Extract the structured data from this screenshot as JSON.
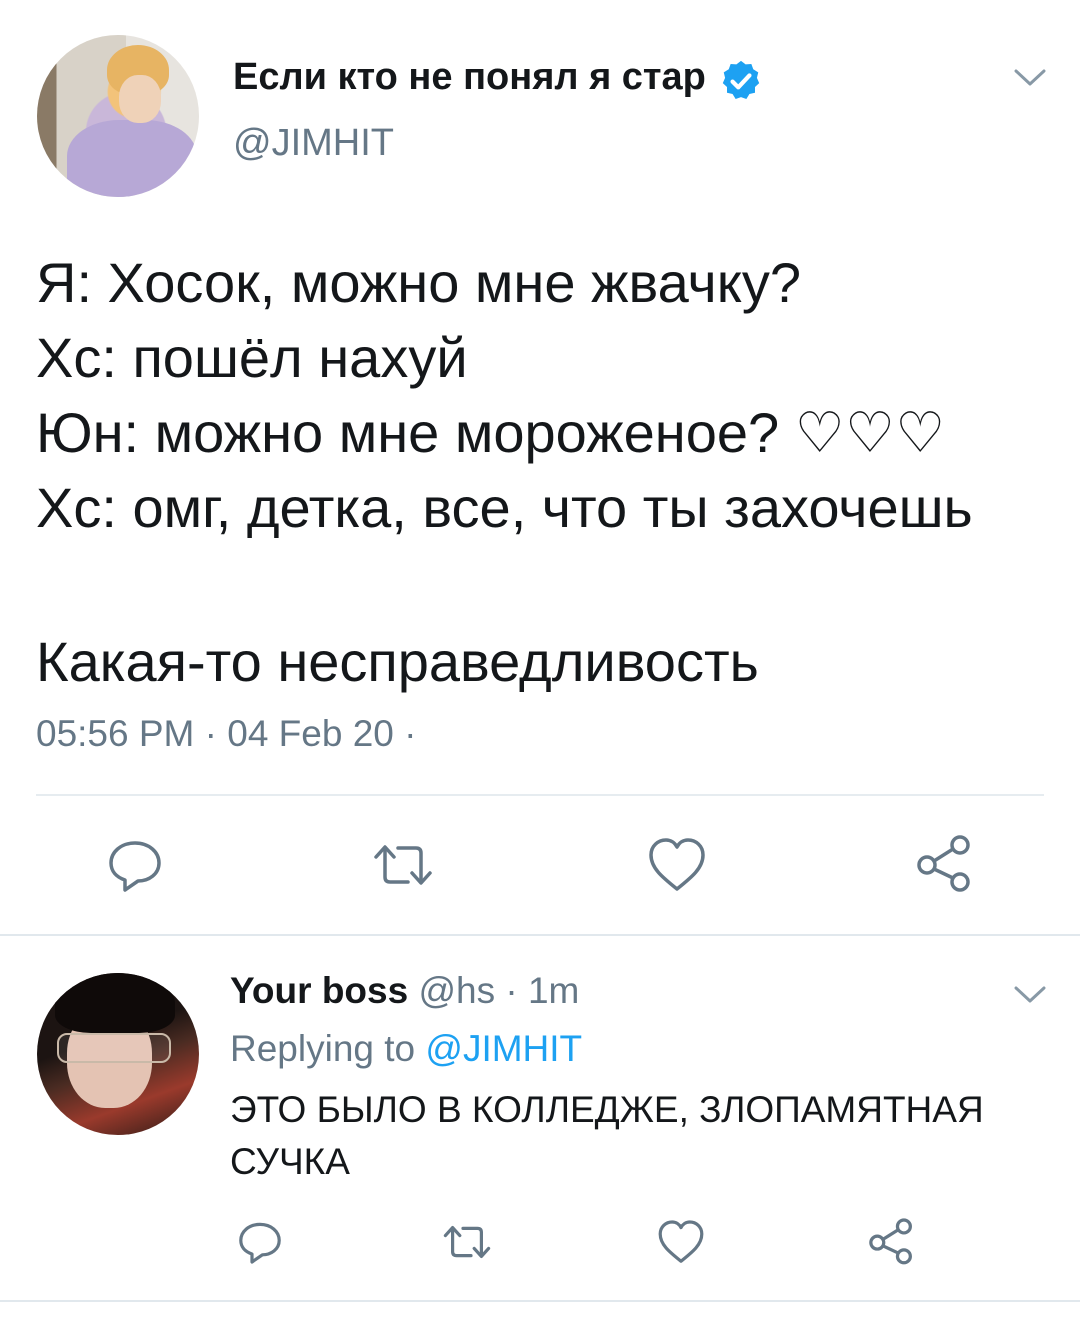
{
  "main_tweet": {
    "author_name": "Если кто не понял я стар",
    "author_handle": "@JIMHIT",
    "verified": true,
    "text_lines": [
      "Я: Хосок, можно мне жвачку?",
      "Хс: пошёл нахуй",
      "Юн: можно мне мороженое? ♡♡♡",
      "Хс: омг, детка, все, что ты захочешь"
    ],
    "text_after": "Какая-то несправедливость",
    "meta": "05:56 PM · 04 Feb 20 ·",
    "actions": [
      "reply-icon",
      "retweet-icon",
      "like-icon",
      "share-icon"
    ]
  },
  "reply": {
    "author_name": "Your boss",
    "author_handle": "@hs",
    "separator": "·",
    "time": "1m",
    "replying_to_label": "Replying to",
    "replying_to_handle": "@JIMHIT",
    "text_lines": [
      "ЭТО БЫЛО В КОЛЛЕДЖЕ, ЗЛОПАМЯТНАЯ",
      "СУЧКА"
    ],
    "actions": [
      "reply-icon",
      "retweet-icon",
      "like-icon",
      "share-icon"
    ]
  },
  "colors": {
    "text_primary": "#14171a",
    "text_secondary": "#657786",
    "accent": "#1da1f2",
    "divider": "#e6ecf0"
  }
}
